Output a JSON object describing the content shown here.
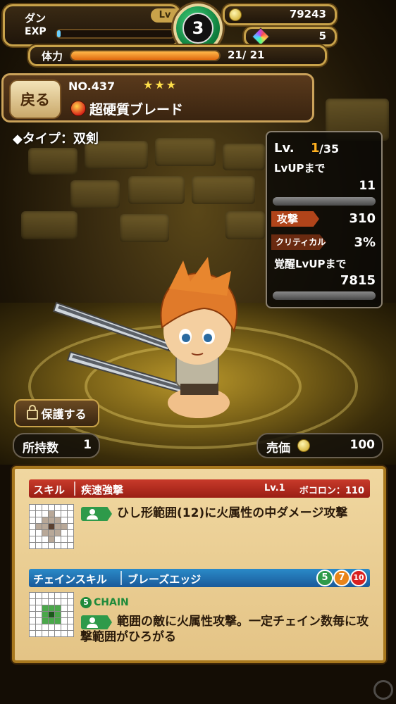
{
  "hud": {
    "player_name": "ダン",
    "exp_label": "EXP",
    "exp_progress": 0.03,
    "lv_label": "Lv",
    "level": "3",
    "coins": "79243",
    "gems": "5",
    "hp_label": "体力",
    "hp_value": "21/ 21",
    "hp_progress": 1.0
  },
  "item": {
    "back_label": "戻る",
    "number": "NO.437",
    "stars": "★★★",
    "name": "超硬質ブレード",
    "type_line": "◆タイプ：双剣"
  },
  "stats": {
    "lv_label": "Lv.",
    "lv_current": "1",
    "lv_max": "/35",
    "lvup_label": "LvUPまで",
    "lvup_value": "11",
    "attack_label": "攻撃",
    "attack_value": "310",
    "crit_label": "クリティカル",
    "crit_value": "3%",
    "awaken_label": "覚醒LvUPまで",
    "awaken_value": "7815"
  },
  "actions": {
    "protect_label": "保護する",
    "owned_label": "所持数",
    "owned_value": "1",
    "price_label": "売価",
    "price_value": "100"
  },
  "skill": {
    "header_label": "スキル",
    "name": "疾速強撃",
    "level": "Lv.1",
    "pokokon_label": "ボコロン：110",
    "description": "ひし形範囲(12)に火属性の中ダメージ攻撃"
  },
  "chain_skill": {
    "header_label": "チェインスキル",
    "name": "ブレーズエッジ",
    "badges": [
      "5",
      "7",
      "10"
    ],
    "chain_num": "5",
    "chain_text": "CHAIN",
    "description": "範囲の敵に火属性攻撃。一定チェイン数毎に攻撃範囲がひろがる"
  },
  "colors": {
    "skill_red": "#c83a2a",
    "chain_blue": "#2a8ac8",
    "badge_green": "#2e9a4a",
    "badge_orange": "#e8841a",
    "badge_red": "#d82020",
    "hp_orange": "#f08a1a",
    "gold": "#c8a24a"
  }
}
